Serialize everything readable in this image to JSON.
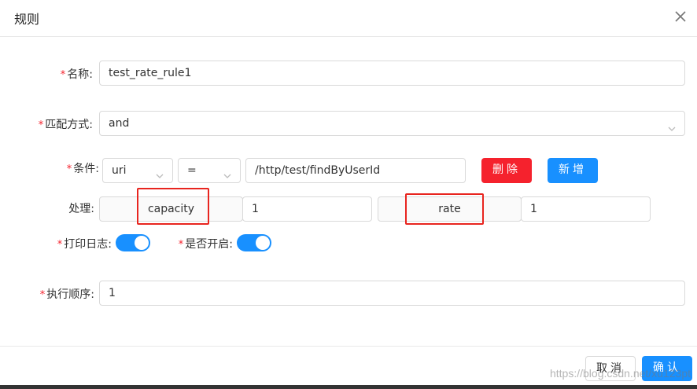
{
  "dialog": {
    "title": "规则",
    "close_icon": "close-icon"
  },
  "form": {
    "name": {
      "label": "名称:",
      "value": "test_rate_rule1"
    },
    "match": {
      "label": "匹配方式:",
      "value": "and"
    },
    "condition": {
      "label": "条件:",
      "field": "uri",
      "operator": "=",
      "value": "/http/test/findByUserId",
      "delete_label": "删除",
      "add_label": "新增"
    },
    "handle": {
      "label": "处理:",
      "items": [
        {
          "key": "capacity",
          "value": "1"
        },
        {
          "key": "rate",
          "value": "1"
        }
      ]
    },
    "log": {
      "label": "打印日志:",
      "on": true
    },
    "enabled": {
      "label": "是否开启:",
      "on": true
    },
    "sort": {
      "label": "执行顺序:",
      "value": "1"
    }
  },
  "footer": {
    "cancel_label": "取消",
    "confirm_label": "确认",
    "watermark": "https://blog.csdn.net/xu123pt"
  },
  "colors": {
    "primary": "#1890ff",
    "danger": "#f5222d",
    "highlight": "#e8251f"
  }
}
